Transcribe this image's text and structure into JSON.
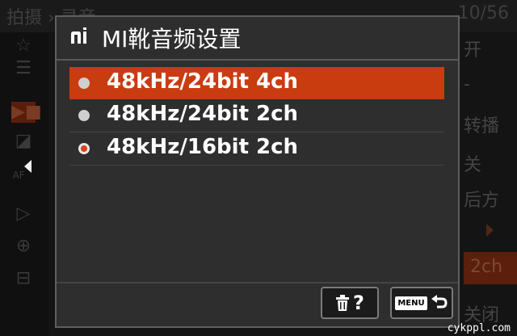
{
  "background": {
    "breadcrumb": "拍摄 › 录音",
    "page_indicator": "10/56",
    "values": [
      "开",
      "-",
      "转播",
      "关",
      "后方",
      "2ch",
      "关闭"
    ],
    "side_icons": [
      "star-icon",
      "menu-list-icon",
      "movie-icon",
      "exposure-icon",
      "af-icon",
      "playback-icon",
      "network-icon",
      "toolbox-icon"
    ],
    "small_label": "AF"
  },
  "dialog": {
    "title": "MI靴音频设置",
    "title_icon": "mi-shoe-icon",
    "options": [
      {
        "label": "48kHz/24bit 4ch",
        "highlighted": true,
        "selected": false
      },
      {
        "label": "48kHz/24bit 2ch",
        "highlighted": false,
        "selected": false
      },
      {
        "label": "48kHz/16bit 2ch",
        "highlighted": false,
        "selected": true
      }
    ],
    "buttons": {
      "delete_help_label": "?",
      "menu_key_label": "MENU"
    }
  },
  "watermark": "cykppl.com",
  "colors": {
    "highlight": "#c93c10",
    "dialog_bg": "#2e2e2e",
    "radio_selected": "#d9431a"
  }
}
